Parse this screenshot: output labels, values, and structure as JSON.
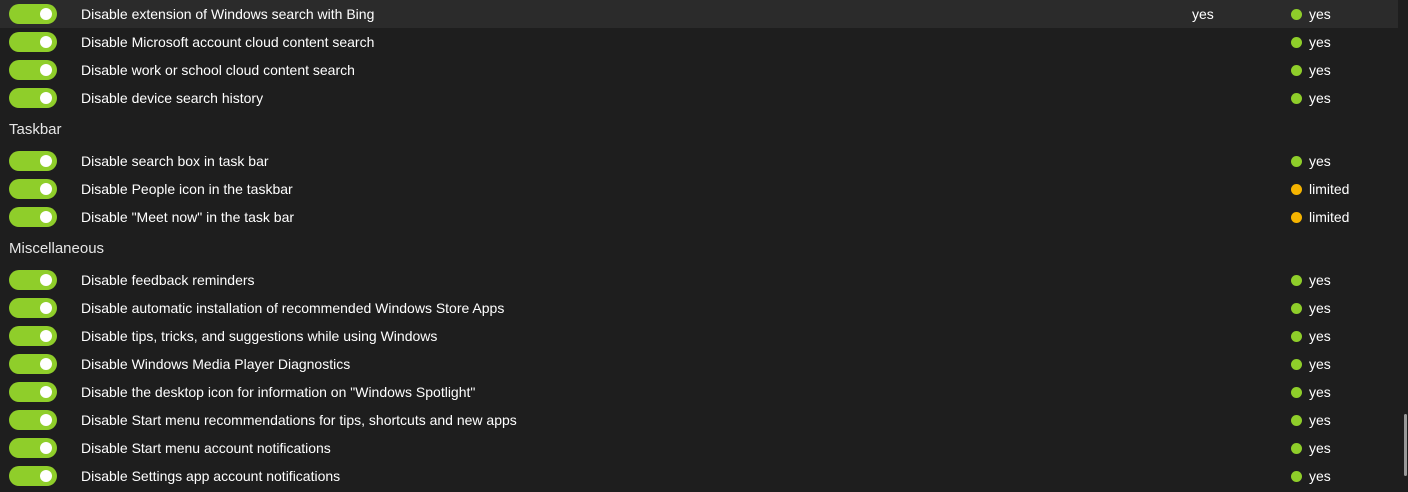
{
  "colors": {
    "accent": "#8fce2a",
    "status_yes": "#8fce2a",
    "status_limited": "#f5b400"
  },
  "groups": [
    {
      "title": "",
      "items": [
        {
          "label": "Disable extension of Windows search with Bing",
          "value": "yes",
          "status": "yes",
          "status_color": "#8fce2a",
          "enabled": true,
          "highlighted": true
        },
        {
          "label": "Disable Microsoft account cloud content search",
          "value": "",
          "status": "yes",
          "status_color": "#8fce2a",
          "enabled": true
        },
        {
          "label": "Disable work or school cloud content search",
          "value": "",
          "status": "yes",
          "status_color": "#8fce2a",
          "enabled": true
        },
        {
          "label": "Disable device search history",
          "value": "",
          "status": "yes",
          "status_color": "#8fce2a",
          "enabled": true
        }
      ]
    },
    {
      "title": "Taskbar",
      "items": [
        {
          "label": "Disable search box in task bar",
          "value": "",
          "status": "yes",
          "status_color": "#8fce2a",
          "enabled": true
        },
        {
          "label": "Disable People icon in the taskbar",
          "value": "",
          "status": "limited",
          "status_color": "#f5b400",
          "enabled": true
        },
        {
          "label": "Disable \"Meet now\" in the task bar",
          "value": "",
          "status": "limited",
          "status_color": "#f5b400",
          "enabled": true
        }
      ]
    },
    {
      "title": "Miscellaneous",
      "items": [
        {
          "label": "Disable feedback reminders",
          "value": "",
          "status": "yes",
          "status_color": "#8fce2a",
          "enabled": true
        },
        {
          "label": "Disable automatic installation of recommended Windows Store Apps",
          "value": "",
          "status": "yes",
          "status_color": "#8fce2a",
          "enabled": true
        },
        {
          "label": "Disable tips, tricks, and suggestions while using Windows",
          "value": "",
          "status": "yes",
          "status_color": "#8fce2a",
          "enabled": true
        },
        {
          "label": "Disable Windows Media Player Diagnostics",
          "value": "",
          "status": "yes",
          "status_color": "#8fce2a",
          "enabled": true
        },
        {
          "label": "Disable the desktop icon for information on \"Windows Spotlight\"",
          "value": "",
          "status": "yes",
          "status_color": "#8fce2a",
          "enabled": true
        },
        {
          "label": "Disable Start menu recommendations for tips, shortcuts and new apps",
          "value": "",
          "status": "yes",
          "status_color": "#8fce2a",
          "enabled": true
        },
        {
          "label": "Disable Start menu account notifications",
          "value": "",
          "status": "yes",
          "status_color": "#8fce2a",
          "enabled": true
        },
        {
          "label": "Disable Settings app account notifications",
          "value": "",
          "status": "yes",
          "status_color": "#8fce2a",
          "enabled": true
        }
      ]
    }
  ]
}
